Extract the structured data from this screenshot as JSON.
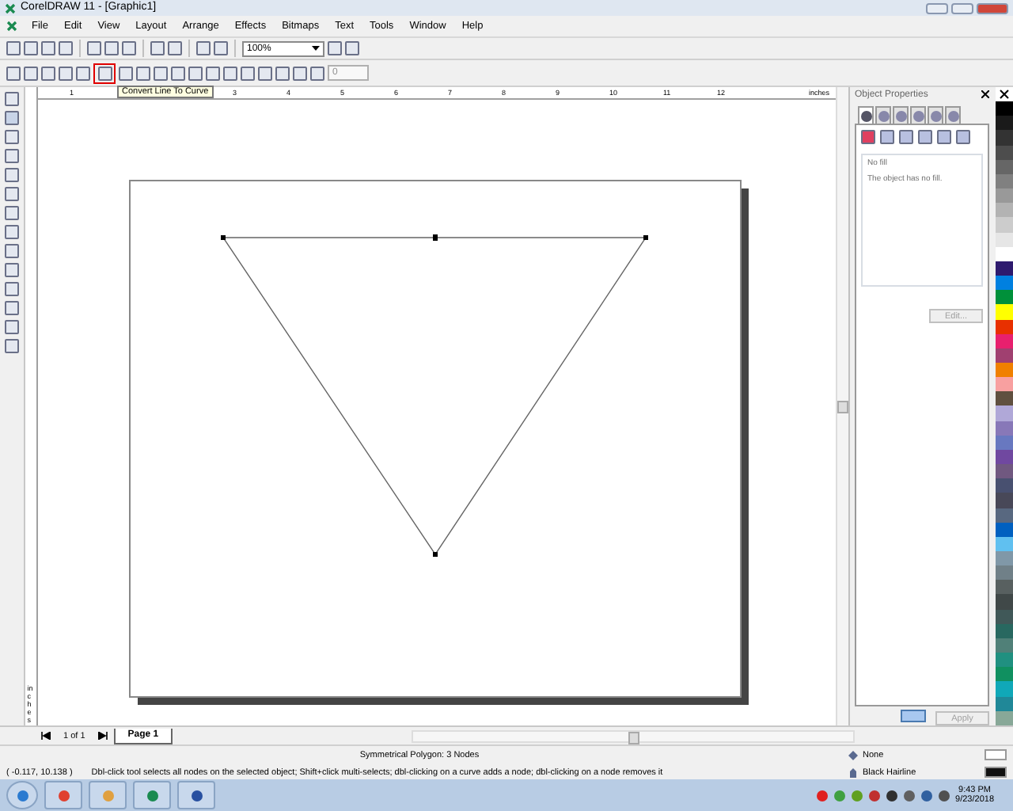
{
  "window": {
    "title": "CorelDRAW 11 - [Graphic1]"
  },
  "menu": [
    "File",
    "Edit",
    "View",
    "Layout",
    "Arrange",
    "Effects",
    "Bitmaps",
    "Text",
    "Tools",
    "Window",
    "Help"
  ],
  "toolbar": {
    "zoom": "100%"
  },
  "property_bar": {
    "tools": [
      {
        "highlighted": false
      },
      {
        "highlighted": false
      },
      {
        "highlighted": false
      },
      {
        "highlighted": false
      },
      {
        "highlighted": false
      },
      {
        "highlighted": true
      },
      {
        "highlighted": false
      },
      {
        "highlighted": false
      },
      {
        "highlighted": false
      },
      {
        "highlighted": false
      },
      {
        "highlighted": false
      },
      {
        "highlighted": false
      },
      {
        "highlighted": false
      },
      {
        "highlighted": false
      },
      {
        "highlighted": false
      },
      {
        "highlighted": false
      },
      {
        "highlighted": false
      },
      {
        "highlighted": false
      }
    ],
    "tooltip": "Convert Line To Curve",
    "node_field": "0"
  },
  "ruler": {
    "marks": [
      "1",
      "3",
      "4",
      "5",
      "6",
      "7",
      "8",
      "9",
      "10",
      "11",
      "12"
    ],
    "unit": "inches",
    "vertical_unit": "inches"
  },
  "object_properties": {
    "title": "Object Properties",
    "tabs": [
      {
        "selected": true
      },
      {
        "selected": false
      },
      {
        "selected": false
      },
      {
        "selected": false
      },
      {
        "selected": false
      },
      {
        "selected": false
      }
    ],
    "group_label": "No fill",
    "description": "The object has no fill.",
    "edit": {
      "label": "Edit...",
      "disabled": true
    },
    "apply": {
      "label": "Apply",
      "disabled": true
    }
  },
  "palette": [
    {
      "color": "#ffffff",
      "kind": "none"
    },
    {
      "color": "#000000"
    },
    {
      "color": "#1a1a1a"
    },
    {
      "color": "#333333"
    },
    {
      "color": "#4d4d4d"
    },
    {
      "color": "#666666"
    },
    {
      "color": "#808080"
    },
    {
      "color": "#999999"
    },
    {
      "color": "#b3b3b3"
    },
    {
      "color": "#cccccc"
    },
    {
      "color": "#e6e6e6"
    },
    {
      "color": "#ffffff"
    },
    {
      "color": "#2e1a6e"
    },
    {
      "color": "#0080e0"
    },
    {
      "color": "#00903a"
    },
    {
      "color": "#ffff00"
    },
    {
      "color": "#e83000"
    },
    {
      "color": "#e8206e"
    },
    {
      "color": "#a04070"
    },
    {
      "color": "#f08000"
    },
    {
      "color": "#f8a0a0"
    },
    {
      "color": "#605040"
    },
    {
      "color": "#b0a8d8"
    },
    {
      "color": "#8878b8"
    },
    {
      "color": "#6878c0"
    },
    {
      "color": "#7048a0"
    },
    {
      "color": "#705880"
    },
    {
      "color": "#485070"
    },
    {
      "color": "#484858"
    },
    {
      "color": "#586880"
    },
    {
      "color": "#0060c0"
    },
    {
      "color": "#60c0f0"
    },
    {
      "color": "#8098a8"
    },
    {
      "color": "#708088"
    },
    {
      "color": "#586060"
    },
    {
      "color": "#404848"
    },
    {
      "color": "#405858"
    },
    {
      "color": "#286860"
    },
    {
      "color": "#508078"
    },
    {
      "color": "#209080"
    },
    {
      "color": "#109060"
    },
    {
      "color": "#10a8b8"
    },
    {
      "color": "#208898"
    },
    {
      "color": "#88a898"
    }
  ],
  "page_nav": {
    "counter": "1 of 1",
    "tabs": [
      {
        "label": "Page 1",
        "selected": true
      }
    ]
  },
  "status_bar": {
    "object": "Symmetrical Polygon: 3 Nodes",
    "coordinates": "( -0.117, 10.138 )",
    "hint": "Dbl-click tool selects all nodes on the selected object; Shift+click multi-selects; dbl-clicking on a curve adds a node; dbl-clicking on a node removes it",
    "fill": "None",
    "outline": "Black  Hairline"
  },
  "taskbar": {
    "time": "9:43 PM",
    "date": "9/23/2018"
  }
}
